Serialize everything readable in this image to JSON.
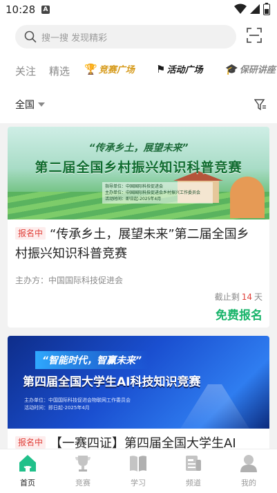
{
  "status_bar": {
    "time": "10:28",
    "notification_icon": "A"
  },
  "search": {
    "placeholder": "搜一搜 发现精彩"
  },
  "tabs": [
    {
      "label": "关注"
    },
    {
      "label": "精选"
    },
    {
      "label": "竞赛广场",
      "icon": "trophy-icon"
    },
    {
      "label": "活动广场",
      "icon": "flag-icon"
    },
    {
      "label": "保研讲座",
      "icon": "graduation-cap-icon"
    }
  ],
  "filter": {
    "region": "全国"
  },
  "cards": [
    {
      "banner_slogan": "“传承乡土，展望未来”",
      "banner_title": "第二届全国乡村振兴知识科普竞赛",
      "banner_info": [
        "指导单位：中国国际科技促进会",
        "主办单位：中国国际科技促进会乡村振兴工作委员会",
        "活动时间：即日起-2025年4月"
      ],
      "status": "报名中",
      "title": "“传承乡土，展望未来”第二届全国乡村振兴知识科普竞赛",
      "organizer": "主办方：中国国际科技促进会",
      "deadline_prefix": "截止剩",
      "deadline_days": "14",
      "deadline_suffix": "天",
      "action": "免费报名"
    },
    {
      "banner_slogan": "“智能时代，智赢未来”",
      "banner_title": "第四届全国大学生AI科技知识竞赛",
      "banner_info": [
        "主办单位：中国国际科技促进会物联网工作委员会",
        "活动时间：即日起-2025年4月"
      ],
      "status": "报名中",
      "title": "【一赛四证】第四届全国大学生AI"
    }
  ],
  "bottom_nav": [
    {
      "label": "首页",
      "icon": "home-icon",
      "active": true
    },
    {
      "label": "竞赛",
      "icon": "trophy-icon"
    },
    {
      "label": "学习",
      "icon": "book-icon"
    },
    {
      "label": "频道",
      "icon": "channel-icon"
    },
    {
      "label": "我的",
      "icon": "user-icon"
    }
  ],
  "colors": {
    "accent_green": "#18b46a",
    "badge_red": "#e0403a",
    "nav_active": "#20c08a"
  }
}
